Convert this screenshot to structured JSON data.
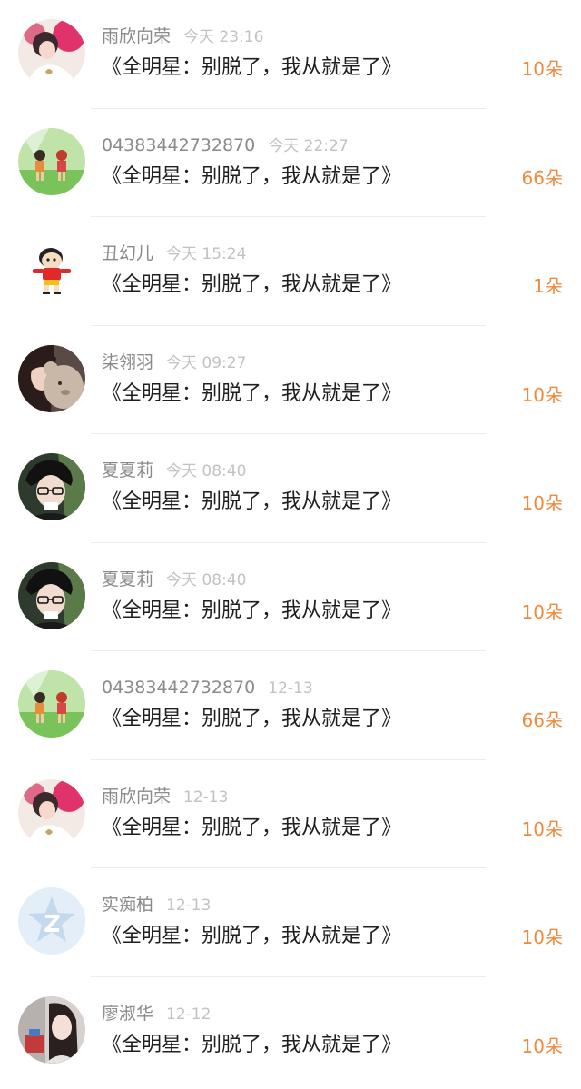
{
  "colors": {
    "username": "#8a8a8a",
    "time": "#c2c2c2",
    "song": "#1f1f1f",
    "flowers": "#ef8a3e",
    "divider": "#ececec"
  },
  "gifts": [
    {
      "user": "雨欣向荣",
      "time": "今天 23:16",
      "song": "《全明星：别脱了，我从就是了》",
      "flowers": "10朵",
      "avatar": "avatar-girl-fan-art"
    },
    {
      "user": "04383442732870",
      "time": "今天 22:27",
      "song": "《全明星：别脱了，我从就是了》",
      "flowers": "66朵",
      "avatar": "avatar-anime-kids-field"
    },
    {
      "user": "丑幻儿",
      "time": "今天 15:24",
      "song": "《全明星：别脱了，我从就是了》",
      "flowers": "1朵",
      "avatar": "avatar-cartoon-boy"
    },
    {
      "user": "柒翎羽",
      "time": "今天 09:27",
      "song": "《全明星：别脱了，我从就是了》",
      "flowers": "10朵",
      "avatar": "avatar-girl-teddy-bear"
    },
    {
      "user": "夏夏莉",
      "time": "今天 08:40",
      "song": "《全明星：别脱了，我从就是了》",
      "flowers": "10朵",
      "avatar": "avatar-boy-glasses"
    },
    {
      "user": "夏夏莉",
      "time": "今天 08:40",
      "song": "《全明星：别脱了，我从就是了》",
      "flowers": "10朵",
      "avatar": "avatar-boy-glasses"
    },
    {
      "user": "04383442732870",
      "time": "12-13",
      "song": "《全明星：别脱了，我从就是了》",
      "flowers": "66朵",
      "avatar": "avatar-anime-kids-field"
    },
    {
      "user": "雨欣向荣",
      "time": "12-13",
      "song": "《全明星：别脱了，我从就是了》",
      "flowers": "10朵",
      "avatar": "avatar-girl-fan-art"
    },
    {
      "user": "实痴柏",
      "time": "12-13",
      "song": "《全明星：别脱了，我从就是了》",
      "flowers": "10朵",
      "avatar": "avatar-default-star"
    },
    {
      "user": "廖淑华",
      "time": "12-12",
      "song": "《全明星：别脱了，我从就是了》",
      "flowers": "10朵",
      "avatar": "avatar-woman-photo"
    }
  ]
}
